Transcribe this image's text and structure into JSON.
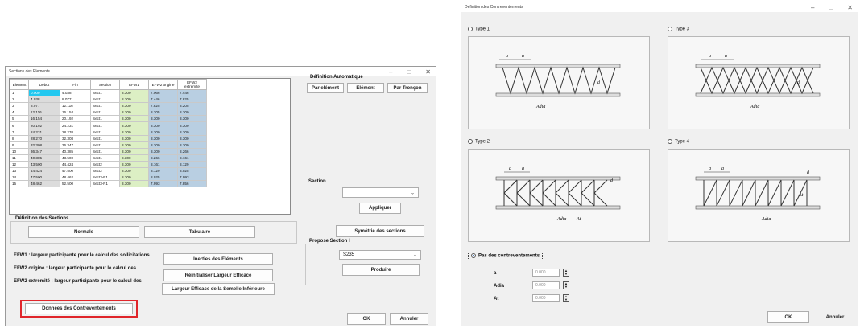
{
  "win1": {
    "title": "Sections des Elements",
    "table": {
      "headers": [
        "Element",
        "Debut",
        "Fin",
        "Section",
        "EFW1",
        "EFW2 origine",
        "EFW2 extremite"
      ],
      "rows": [
        [
          "1",
          "0.000",
          "4.038",
          "Sect1",
          "8.300",
          "7.066",
          "7.446"
        ],
        [
          "2",
          "4.038",
          "8.077",
          "Sect1",
          "8.300",
          "7.446",
          "7.825"
        ],
        [
          "3",
          "8.077",
          "12.116",
          "Sect1",
          "8.300",
          "7.825",
          "8.205"
        ],
        [
          "4",
          "12.116",
          "16.154",
          "Sect1",
          "8.300",
          "8.205",
          "8.300"
        ],
        [
          "5",
          "16.154",
          "20.192",
          "Sect1",
          "8.300",
          "8.300",
          "8.300"
        ],
        [
          "6",
          "20.192",
          "24.231",
          "Sect1",
          "8.300",
          "8.300",
          "8.300"
        ],
        [
          "7",
          "24.231",
          "28.270",
          "Sect1",
          "8.300",
          "8.300",
          "8.300"
        ],
        [
          "8",
          "28.270",
          "32.308",
          "Sect1",
          "8.300",
          "8.300",
          "8.300"
        ],
        [
          "9",
          "32.308",
          "36.347",
          "Sect1",
          "8.300",
          "8.300",
          "8.300"
        ],
        [
          "10",
          "36.347",
          "40.385",
          "Sect1",
          "8.300",
          "8.300",
          "8.266"
        ],
        [
          "11",
          "40.385",
          "43.500",
          "Sect1",
          "8.300",
          "8.266",
          "8.161"
        ],
        [
          "12",
          "43.500",
          "44.424",
          "Sect2",
          "8.300",
          "8.161",
          "8.129"
        ],
        [
          "13",
          "44.424",
          "47.500",
          "Sect2",
          "8.300",
          "8.129",
          "8.025"
        ],
        [
          "14",
          "47.500",
          "48.462",
          "Sect3-P1",
          "8.300",
          "8.025",
          "7.993"
        ],
        [
          "15",
          "48.462",
          "52.500",
          "Sect3-P1",
          "8.300",
          "7.993",
          "7.856"
        ]
      ]
    },
    "auto_def_title": "Définition Automatique",
    "btn_par_element": "Par elément",
    "btn_element": "Elément",
    "btn_par_troncon": "Par Tronçon",
    "section_label": "Section",
    "btn_appliquer": "Appliquer",
    "btn_symetrie": "Symétrie des sections",
    "propose_title": "Propose Section I",
    "propose_value": "S235",
    "btn_produire": "Produire",
    "def_sections_title": "Définition des Sections",
    "btn_normale": "Normale",
    "btn_tabulaire": "Tabulaire",
    "info1": "EFW1 : largeur participante pour le calcul des sollicitations",
    "info2": "EFW2 origine : largeur participante pour le calcul des",
    "info3": "EFW2 extrémité : largeur participante pour le calcul des",
    "btn_inerties": "Inerties des Eléments",
    "btn_reinit": "Réinitialiser Largeur Efficace",
    "btn_largeur": "Largeur Efficace de la Semelle Inférieure",
    "btn_donnees": "Données des Contreventements",
    "btn_ok": "OK",
    "btn_annuler": "Annuler",
    "highlight_color": "#e0262b"
  },
  "win2": {
    "title": "Definition des Contreventements",
    "type1": "Type 1",
    "type2": "Type 2",
    "type3": "Type 3",
    "type4": "Type 4",
    "pas_label": "Pas des contreventements",
    "a_label": "a",
    "adia_label": "Adia",
    "at_label": "At",
    "a_value": "0.000",
    "adia_value": "0.000",
    "at_value": "0.000",
    "fig_a": "a",
    "fig_d": "d",
    "fig_adia": "Adia",
    "fig_at": "At",
    "btn_ok": "OK",
    "btn_annuler": "Annuler"
  }
}
